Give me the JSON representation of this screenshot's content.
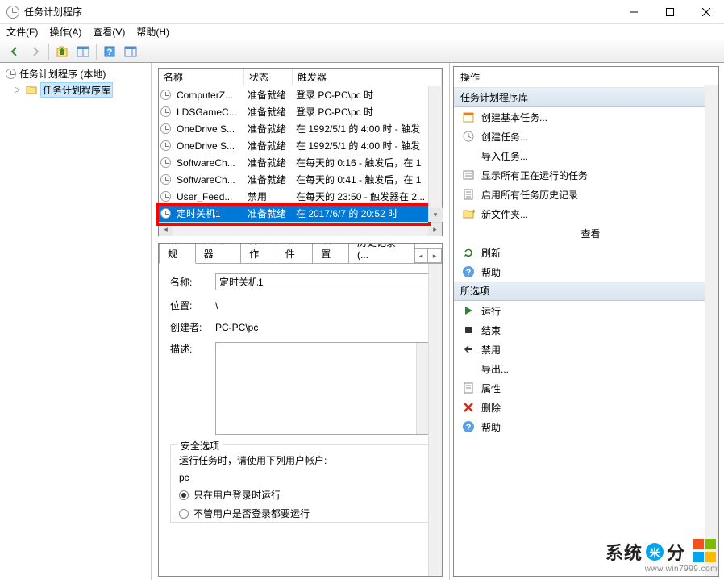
{
  "title": "任务计划程序",
  "menu": {
    "file": "文件(F)",
    "action": "操作(A)",
    "view": "查看(V)",
    "help": "帮助(H)"
  },
  "tree": {
    "root": "任务计划程序 (本地)",
    "library": "任务计划程序库"
  },
  "columns": {
    "name": "名称",
    "status": "状态",
    "triggers": "触发器"
  },
  "tasks": [
    {
      "name": "ComputerZ...",
      "status": "准备就绪",
      "trigger": "登录 PC-PC\\pc 时"
    },
    {
      "name": "LDSGameC...",
      "status": "准备就绪",
      "trigger": "登录 PC-PC\\pc 时"
    },
    {
      "name": "OneDrive S...",
      "status": "准备就绪",
      "trigger": "在 1992/5/1 的 4:00 时 - 触发"
    },
    {
      "name": "OneDrive S...",
      "status": "准备就绪",
      "trigger": "在 1992/5/1 的 4:00 时 - 触发"
    },
    {
      "name": "SoftwareCh...",
      "status": "准备就绪",
      "trigger": "在每天的 0:16 - 触发后，在 1"
    },
    {
      "name": "SoftwareCh...",
      "status": "准备就绪",
      "trigger": "在每天的 0:41 - 触发后，在 1"
    },
    {
      "name": "User_Feed...",
      "status": "禁用",
      "trigger": "在每天的 23:50 - 触发器在 2..."
    },
    {
      "name": "定时关机1",
      "status": "准备就绪",
      "trigger": "在 2017/6/7 的 20:52 时"
    }
  ],
  "tabs": {
    "general": "常规",
    "triggers": "触发器",
    "actions": "操作",
    "conditions": "条件",
    "settings": "设置",
    "history": "历史记录(..."
  },
  "form": {
    "name_label": "名称:",
    "name_value": "定时关机1",
    "location_label": "位置:",
    "location_value": "\\",
    "author_label": "创建者:",
    "author_value": "PC-PC\\pc",
    "desc_label": "描述:",
    "security_title": "安全选项",
    "security_text": "运行任务时，请使用下列用户帐户:",
    "security_user": "pc",
    "radio1": "只在用户登录时运行",
    "radio2": "不管用户是否登录都要运行"
  },
  "actions_panel": {
    "header": "操作",
    "group1": "任务计划程序库",
    "items1": [
      "创建基本任务...",
      "创建任务...",
      "导入任务...",
      "显示所有正在运行的任务",
      "启用所有任务历史记录",
      "新文件夹...",
      "查看",
      "刷新",
      "帮助"
    ],
    "group2": "所选项",
    "items2": [
      "运行",
      "结束",
      "禁用",
      "导出...",
      "属性",
      "删除",
      "帮助"
    ]
  },
  "watermark": {
    "brand_a": "系统",
    "brand_b": "分",
    "url": "www.win7999.com",
    "colors": {
      "tl": "#f25022",
      "tr": "#7fba00",
      "bl": "#00a4ef",
      "br": "#ffb900",
      "c1": "#00a4ef",
      "c2": "#f25022"
    }
  }
}
